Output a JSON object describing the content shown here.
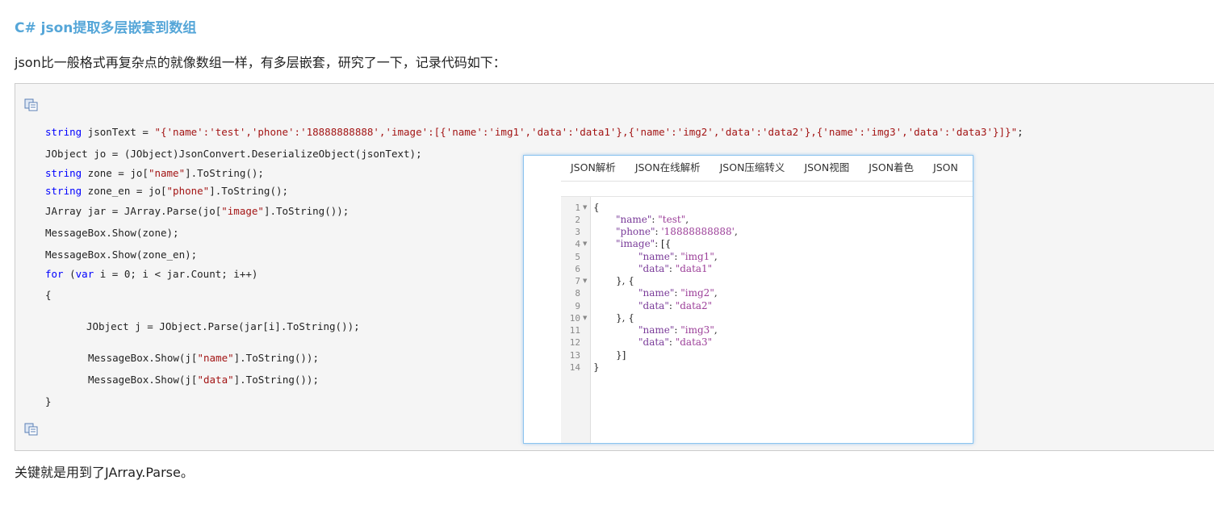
{
  "article": {
    "title": "C# json提取多层嵌套到数组",
    "intro": "json比一般格式再复杂点的就像数组一样，有多层嵌套，研究了一下，记录代码如下：",
    "outro": "关键就是用到了JArray.Parse。"
  },
  "code": {
    "line1_kw": "string",
    "line1_mid": " jsonText = ",
    "line1_str": "\"{'name':'test','phone':'18888888888','image':[{'name':'img1','data':'data1'},{'name':'img2','data':'data2'},{'name':'img3','data':'data3'}]}\"",
    "line1_end": ";",
    "line2": "JObject jo = (JObject)JsonConvert.DeserializeObject(jsonText);",
    "line3_kw": "string",
    "line3_a": " zone = jo[",
    "line3_str": "\"name\"",
    "line3_b": "].ToString();",
    "line4_kw": "string",
    "line4_a": " zone_en = jo[",
    "line4_str": "\"phone\"",
    "line4_b": "].ToString();",
    "line5_a": "JArray jar = JArray.Parse(jo[",
    "line5_str": "\"image\"",
    "line5_b": "].ToString());",
    "line6": "MessageBox.Show(zone);",
    "line7": "MessageBox.Show(zone_en);",
    "line8_kw1": "for",
    "line8_a": " (",
    "line8_kw2": "var",
    "line8_b": " i = 0; i < jar.Count; i++)",
    "line9": "{",
    "line10": "JObject j = JObject.Parse(jar[i].ToString());",
    "line11_a": "MessageBox.Show(j[",
    "line11_str": "\"name\"",
    "line11_b": "].ToString());",
    "line12_a": "MessageBox.Show(j[",
    "line12_str": "\"data\"",
    "line12_b": "].ToString());",
    "line13": "}"
  },
  "popup": {
    "tabs": [
      "JSON解析",
      "JSON在线解析",
      "JSON压缩转义",
      "JSON视图",
      "JSON着色",
      "JSON"
    ],
    "line_numbers": [
      "1",
      "2",
      "3",
      "4",
      "5",
      "6",
      "7",
      "8",
      "9",
      "10",
      "11",
      "12",
      "13",
      "14"
    ],
    "fold_marker": "▼",
    "json": {
      "open": "{",
      "k_name": "\"name\"",
      "v_test": "\"test\"",
      "k_phone": "\"phone\"",
      "v_phone": "'18888888888'",
      "k_image": "\"image\"",
      "image_open": ": [{",
      "v_img1": "\"img1\"",
      "v_data1": "\"data1\"",
      "k_data": "\"data\"",
      "sep": "}, {",
      "v_img2": "\"img2\"",
      "v_data2": "\"data2\"",
      "v_img3": "\"img3\"",
      "v_data3": "\"data3\"",
      "arr_close": "}]",
      "close": "}",
      "colon": ": ",
      "comma": ","
    }
  },
  "icons": {
    "copy": "copy-icon"
  }
}
